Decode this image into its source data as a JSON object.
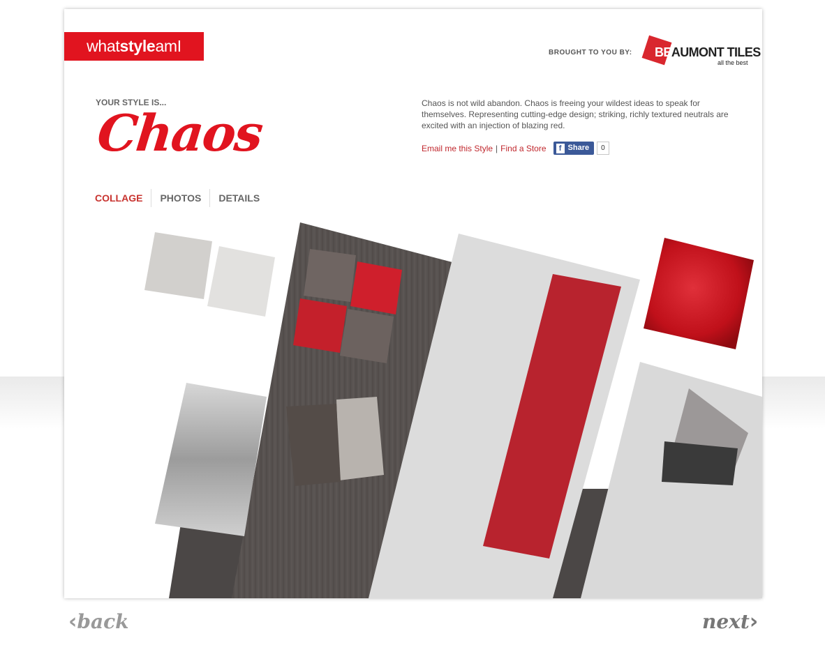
{
  "header": {
    "logo": {
      "pre": "what",
      "mid": "style",
      "post": "amI"
    },
    "brought_to_you_by": "BROUGHT TO YOU BY:",
    "sponsor": {
      "name_a": "BE",
      "name_b": "AUMONT TILES",
      "tagline": "all the best"
    }
  },
  "result": {
    "intro": "YOUR STYLE IS...",
    "style_name": "Chaos",
    "description": "Chaos is not wild abandon. Chaos is freeing your wildest ideas to speak for themselves. Representing cutting-edge design; striking, richly textured neutrals are excited with an injection of blazing red."
  },
  "actions": {
    "email": "Email me this Style",
    "separator": "|",
    "find_store": "Find a Store",
    "share_label": "Share",
    "share_count": "0",
    "share_glyph": "f"
  },
  "tabs": [
    "COLLAGE",
    "PHOTOS",
    "DETAILS"
  ],
  "nav": {
    "back": "back",
    "next": "next",
    "back_glyph": "‹",
    "next_glyph": "›"
  },
  "colors": {
    "accent": "#e1141f",
    "link": "#c0272d",
    "facebook": "#3b5998"
  }
}
